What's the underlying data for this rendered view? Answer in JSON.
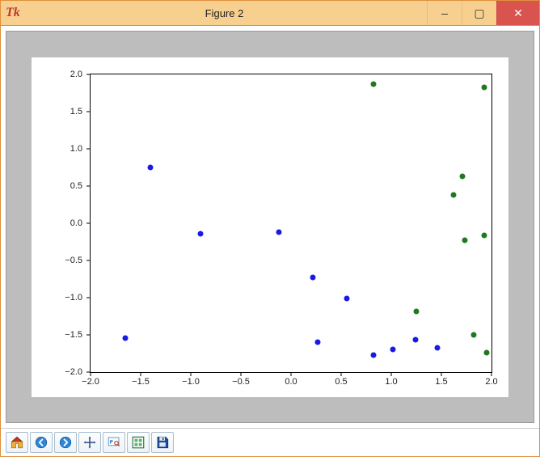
{
  "window": {
    "title": "Figure 2",
    "tk_glyph": "Tk",
    "min_label": "–",
    "max_label": "▢",
    "close_label": "✕"
  },
  "toolbar": {
    "home": "home-icon",
    "back": "back-icon",
    "forward": "forward-icon",
    "pan": "pan-icon",
    "zoom": "zoom-icon",
    "subplots": "subplots-icon",
    "save": "save-icon"
  },
  "chart_data": {
    "type": "scatter",
    "xlim": [
      -2.0,
      2.0
    ],
    "ylim": [
      -2.0,
      2.0
    ],
    "xticks": [
      -2.0,
      -1.5,
      -1.0,
      -0.5,
      0.0,
      0.5,
      1.0,
      1.5,
      2.0
    ],
    "yticks": [
      -2.0,
      -1.5,
      -1.0,
      -0.5,
      0.0,
      0.5,
      1.0,
      1.5,
      2.0
    ],
    "xtick_labels": [
      "−2.0",
      "−1.5",
      "−1.0",
      "−0.5",
      "0.0",
      "0.5",
      "1.0",
      "1.5",
      "2.0"
    ],
    "ytick_labels": [
      "−2.0",
      "−1.5",
      "−1.0",
      "−0.5",
      "0.0",
      "0.5",
      "1.0",
      "1.5",
      "2.0"
    ],
    "series": [
      {
        "name": "blue",
        "color": "#1a1ae6",
        "points": [
          {
            "x": -1.65,
            "y": -1.55
          },
          {
            "x": -1.4,
            "y": 0.74
          },
          {
            "x": -0.9,
            "y": -0.15
          },
          {
            "x": -0.12,
            "y": -0.12
          },
          {
            "x": 0.22,
            "y": -0.73
          },
          {
            "x": 0.27,
            "y": -1.6
          },
          {
            "x": 0.56,
            "y": -1.02
          },
          {
            "x": 0.82,
            "y": -1.78
          },
          {
            "x": 1.02,
            "y": -1.7
          },
          {
            "x": 1.24,
            "y": -1.57
          },
          {
            "x": 1.46,
            "y": -1.68
          }
        ]
      },
      {
        "name": "green",
        "color": "#1d7a1d",
        "points": [
          {
            "x": 0.82,
            "y": 1.86
          },
          {
            "x": 1.25,
            "y": -1.19
          },
          {
            "x": 1.62,
            "y": 0.38
          },
          {
            "x": 1.71,
            "y": 0.62
          },
          {
            "x": 1.73,
            "y": -0.23
          },
          {
            "x": 1.82,
            "y": -1.5
          },
          {
            "x": 1.93,
            "y": 1.82
          },
          {
            "x": 1.93,
            "y": -0.17
          },
          {
            "x": 1.95,
            "y": -1.74
          }
        ]
      }
    ]
  }
}
